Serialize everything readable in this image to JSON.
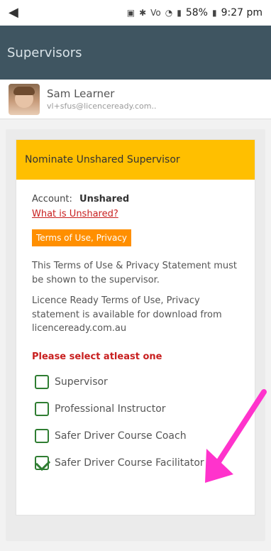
{
  "status_bar": {
    "battery": "58%",
    "time": "9:27 pm"
  },
  "app_bar": {
    "title": "Supervisors"
  },
  "user": {
    "name": "Sam Learner",
    "email": "vl+sfus@licenceready.com.."
  },
  "card": {
    "title": "Nominate Unshared Supervisor",
    "account_label": "Account:",
    "account_value": "Unshared",
    "unshared_link": "What is Unshared?",
    "terms_label": "Terms of Use, Privacy",
    "text1": "This Terms of Use & Privacy Statement must be shown to the supervisor.",
    "text2": "Licence Ready Terms of Use, Privacy statement is available for download from licenceready.com.au",
    "select_label": "Please select atleast one",
    "options": [
      {
        "label": "Supervisor",
        "checked": false
      },
      {
        "label": "Professional Instructor",
        "checked": false
      },
      {
        "label": "Safer Driver Course Coach",
        "checked": false
      },
      {
        "label": "Safer Driver Course Facilitator",
        "checked": true
      }
    ]
  },
  "colors": {
    "appbar": "#3f5561",
    "header": "#ffbf00",
    "accent": "#ff8f00",
    "link": "#c81f1f",
    "checkbox": "#2f7d32",
    "annotation_arrow": "#ff33cc"
  }
}
